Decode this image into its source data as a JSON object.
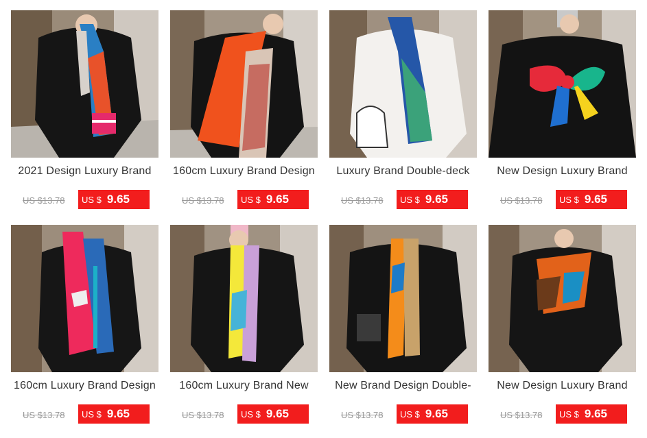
{
  "products": [
    {
      "title": "2021 Design Luxury Brand",
      "old_price": "US $13.78",
      "currency": "US $",
      "price": "9.65",
      "image": "woman-black-outfit-blue-orange-striped-scarf"
    },
    {
      "title": "160cm Luxury Brand Design",
      "old_price": "US $13.78",
      "currency": "US $",
      "price": "9.65",
      "image": "woman-black-outfit-orange-geometric-scarf"
    },
    {
      "title": "Luxury Brand Double-deck",
      "old_price": "US $13.78",
      "currency": "US $",
      "price": "9.65",
      "image": "woman-white-blouse-blue-green-scarf"
    },
    {
      "title": "New Design Luxury Brand",
      "old_price": "US $13.78",
      "currency": "US $",
      "price": "9.65",
      "image": "woman-black-top-red-green-bow-scarf"
    },
    {
      "title": "160cm Luxury Brand Design",
      "old_price": "US $13.78",
      "currency": "US $",
      "price": "9.65",
      "image": "woman-black-outfit-pink-horse-print-scarf"
    },
    {
      "title": "160cm Luxury Brand New",
      "old_price": "US $13.78",
      "currency": "US $",
      "price": "9.65",
      "image": "woman-black-outfit-yellow-lilac-scarf"
    },
    {
      "title": "New Brand Design Double-",
      "old_price": "US $13.78",
      "currency": "US $",
      "price": "9.65",
      "image": "woman-black-outfit-orange-yellow-scarf"
    },
    {
      "title": "New Design Luxury Brand",
      "old_price": "US $13.78",
      "currency": "US $",
      "price": "9.65",
      "image": "woman-black-outfit-orange-brown-scarf"
    }
  ],
  "colors": {
    "price_badge": "#f21d1d",
    "title_text": "#333333",
    "old_price_text": "#999999"
  }
}
